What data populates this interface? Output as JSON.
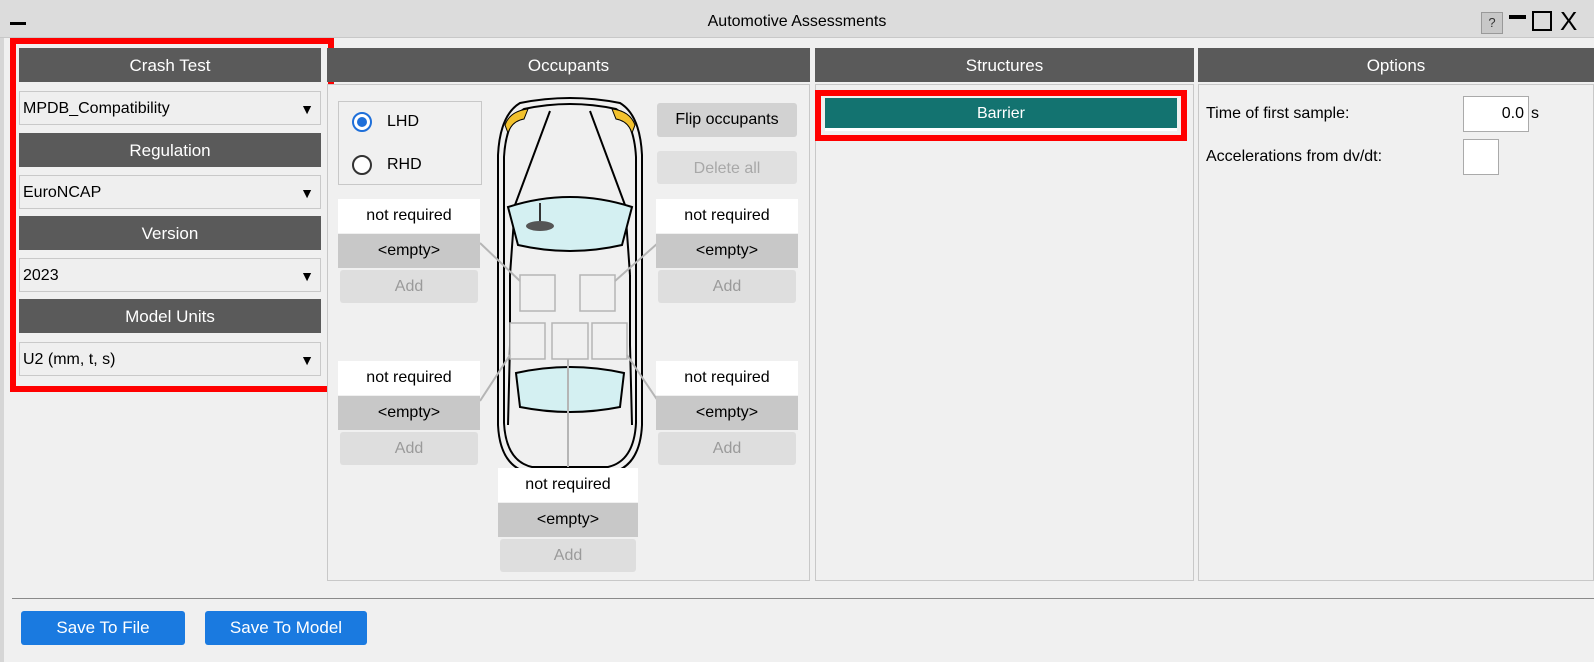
{
  "window": {
    "title": "Automotive Assessments",
    "help_label": "?",
    "close_glyph": "X"
  },
  "crash_panel": {
    "crash_test_header": "Crash Test",
    "crash_test_value": "MPDB_Compatibility",
    "regulation_header": "Regulation",
    "regulation_value": "EuroNCAP",
    "version_header": "Version",
    "version_value": "2023",
    "units_header": "Model Units",
    "units_value": "U2 (mm, t, s)",
    "dropdown_arrow": "▼"
  },
  "occupants": {
    "header": "Occupants",
    "lhd_label": "LHD",
    "rhd_label": "RHD",
    "selected_drive": "LHD",
    "flip_label": "Flip occupants",
    "delete_all_label": "Delete all",
    "slots": [
      {
        "status": "not required",
        "value": "<empty>",
        "add": "Add"
      },
      {
        "status": "not required",
        "value": "<empty>",
        "add": "Add"
      },
      {
        "status": "not required",
        "value": "<empty>",
        "add": "Add"
      },
      {
        "status": "not required",
        "value": "<empty>",
        "add": "Add"
      },
      {
        "status": "not required",
        "value": "<empty>",
        "add": "Add"
      }
    ]
  },
  "structures": {
    "header": "Structures",
    "items": [
      "Barrier"
    ]
  },
  "options": {
    "header": "Options",
    "first_sample_label": "Time of first sample:",
    "first_sample_value": "0.0",
    "first_sample_unit": "s",
    "accel_label": "Accelerations from dv/dt:",
    "accel_checked": false
  },
  "footer": {
    "save_file_label": "Save To File",
    "save_model_label": "Save To Model"
  },
  "colors": {
    "highlight_red": "#ff0000",
    "header_grey": "#5a5a5a",
    "barrier_teal": "#137370",
    "button_blue": "#1a7ae0",
    "radio_blue": "#1e6fd9",
    "glass_cyan": "#d4f0f2",
    "light_yellow": "#f2c12e"
  }
}
